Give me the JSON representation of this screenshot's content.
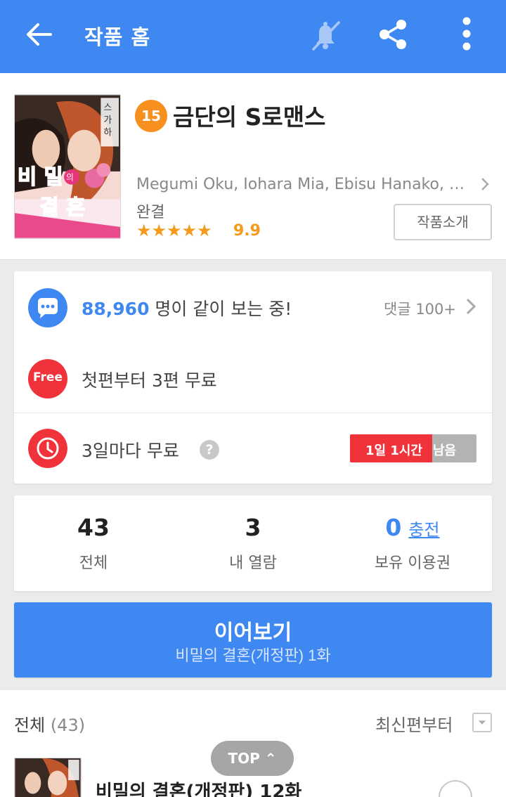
{
  "topbar": {
    "title": "작품 홈",
    "icons": {
      "back": "back-arrow-icon",
      "bell": "notification-off-icon",
      "share": "share-icon",
      "more": "more-vertical-icon"
    },
    "color": "#3f88f2"
  },
  "work": {
    "age_rating": "15",
    "title": "금단의 S로맨스",
    "authors": "Megumi Oku, Iohara Mia, Ebisu Hanako, Ryo...",
    "status": "완결",
    "stars": "★★★★★",
    "rating": "9.9",
    "intro_button": "작품소개",
    "cover_text": {
      "main": "비밀 결혼",
      "small": "의",
      "side": "스가하라 류"
    }
  },
  "viewers": {
    "count": "88,960",
    "text": " 명이 같이 보는 중!",
    "comments": "댓글 100+"
  },
  "free": {
    "badge": "Free",
    "text": "첫편부터 3편 무료"
  },
  "wait_free": {
    "text": "3일마다 무료",
    "help": "?",
    "remaining_time": "1일 1시간",
    "remaining_suffix": "남음",
    "remaining_fraction": 0.65
  },
  "stats": {
    "total": {
      "value": "43",
      "label": "전체"
    },
    "read": {
      "value": "3",
      "label": "내 열람"
    },
    "tickets": {
      "value": "0",
      "charge": "충전",
      "label": "보유 이용권"
    }
  },
  "continue": {
    "label": "이어보기",
    "episode": "비밀의 결혼(개정판) 1화"
  },
  "list": {
    "header": "전체",
    "count": "(43)",
    "sort": "최신편부터",
    "top_button": "TOP",
    "episodes": [
      {
        "title": "비밀의 결혼(개정판) 12화"
      }
    ]
  },
  "colors": {
    "accent": "#3f88f2",
    "alert": "#f0323b",
    "star": "#f59a1b"
  }
}
